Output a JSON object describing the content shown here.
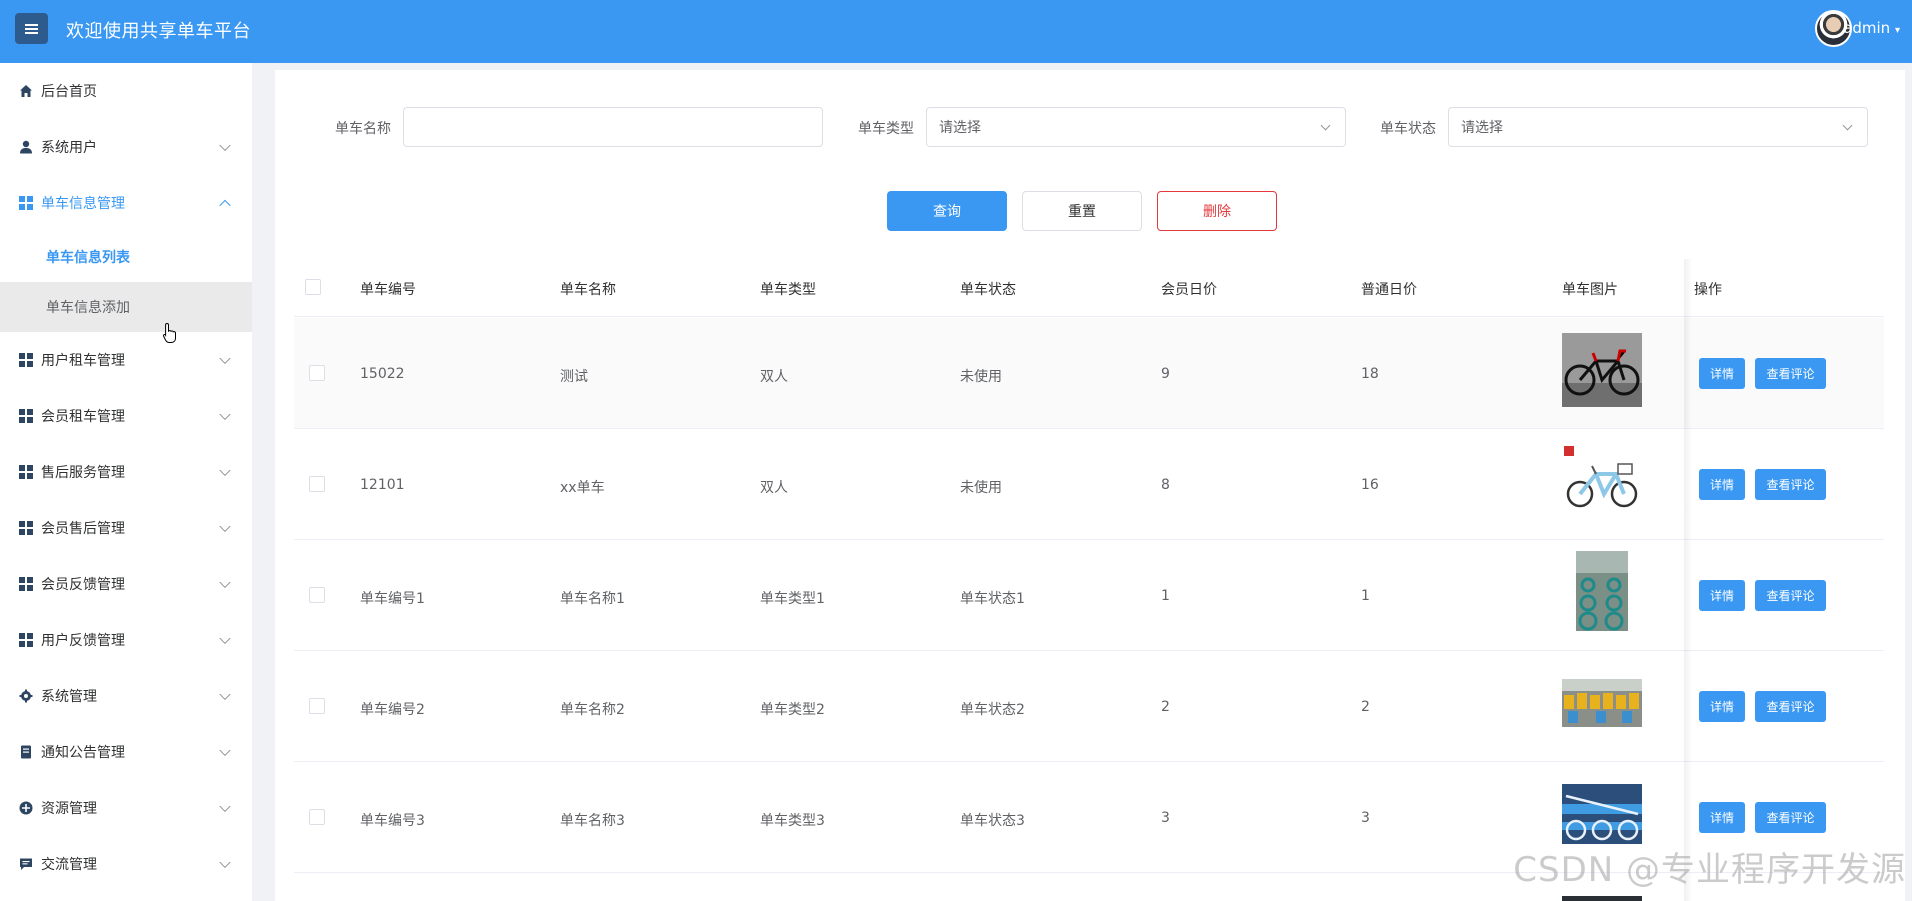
{
  "header": {
    "title": "欢迎使用共享单车平台",
    "username": "admin",
    "brand_color": "#3a98f3"
  },
  "sidebar": {
    "items": [
      {
        "label": "后台首页",
        "icon": "home-icon"
      },
      {
        "label": "系统用户",
        "icon": "user-icon"
      },
      {
        "label": "单车信息管理",
        "icon": "grid-icon",
        "expanded": true,
        "children": [
          {
            "label": "单车信息列表",
            "current": true
          },
          {
            "label": "单车信息添加"
          }
        ]
      },
      {
        "label": "用户租车管理",
        "icon": "grid-icon"
      },
      {
        "label": "会员租车管理",
        "icon": "grid-icon"
      },
      {
        "label": "售后服务管理",
        "icon": "grid-icon"
      },
      {
        "label": "会员售后管理",
        "icon": "grid-icon"
      },
      {
        "label": "会员反馈管理",
        "icon": "grid-icon"
      },
      {
        "label": "用户反馈管理",
        "icon": "grid-icon"
      },
      {
        "label": "系统管理",
        "icon": "gear-icon"
      },
      {
        "label": "通知公告管理",
        "icon": "notice-icon"
      },
      {
        "label": "资源管理",
        "icon": "resource-icon"
      },
      {
        "label": "交流管理",
        "icon": "chat-icon"
      }
    ]
  },
  "filters": {
    "name_label": "单车名称",
    "name_value": "",
    "type_label": "单车类型",
    "type_value": "请选择",
    "status_label": "单车状态",
    "status_value": "请选择"
  },
  "buttons": {
    "query": "查询",
    "reset": "重置",
    "delete": "删除"
  },
  "table": {
    "columns": [
      "单车编号",
      "单车名称",
      "单车类型",
      "单车状态",
      "会员日价",
      "普通日价",
      "单车图片",
      "操作"
    ],
    "rows": [
      {
        "id": "15022",
        "name": "测试",
        "type": "双人",
        "status": "未使用",
        "member_price": "9",
        "price": "18",
        "image": "black-mountain-bike"
      },
      {
        "id": "12101",
        "name": "xx单车",
        "type": "双人",
        "status": "未使用",
        "member_price": "8",
        "price": "16",
        "image": "blue-city-bike"
      },
      {
        "id": "单车编号1",
        "name": "单车名称1",
        "type": "单车类型1",
        "status": "单车状态1",
        "member_price": "1",
        "price": "1",
        "image": "parked-bikes-row"
      },
      {
        "id": "单车编号2",
        "name": "单车名称2",
        "type": "单车类型2",
        "status": "单车状态2",
        "member_price": "2",
        "price": "2",
        "image": "yellow-bikes-lot"
      },
      {
        "id": "单车编号3",
        "name": "单车名称3",
        "type": "单车类型3",
        "status": "单车状态3",
        "member_price": "3",
        "price": "3",
        "image": "blue-bikes-row"
      }
    ],
    "action_detail": "详情",
    "action_comments": "查看评论"
  },
  "watermark": "CSDN @专业程序开发源"
}
